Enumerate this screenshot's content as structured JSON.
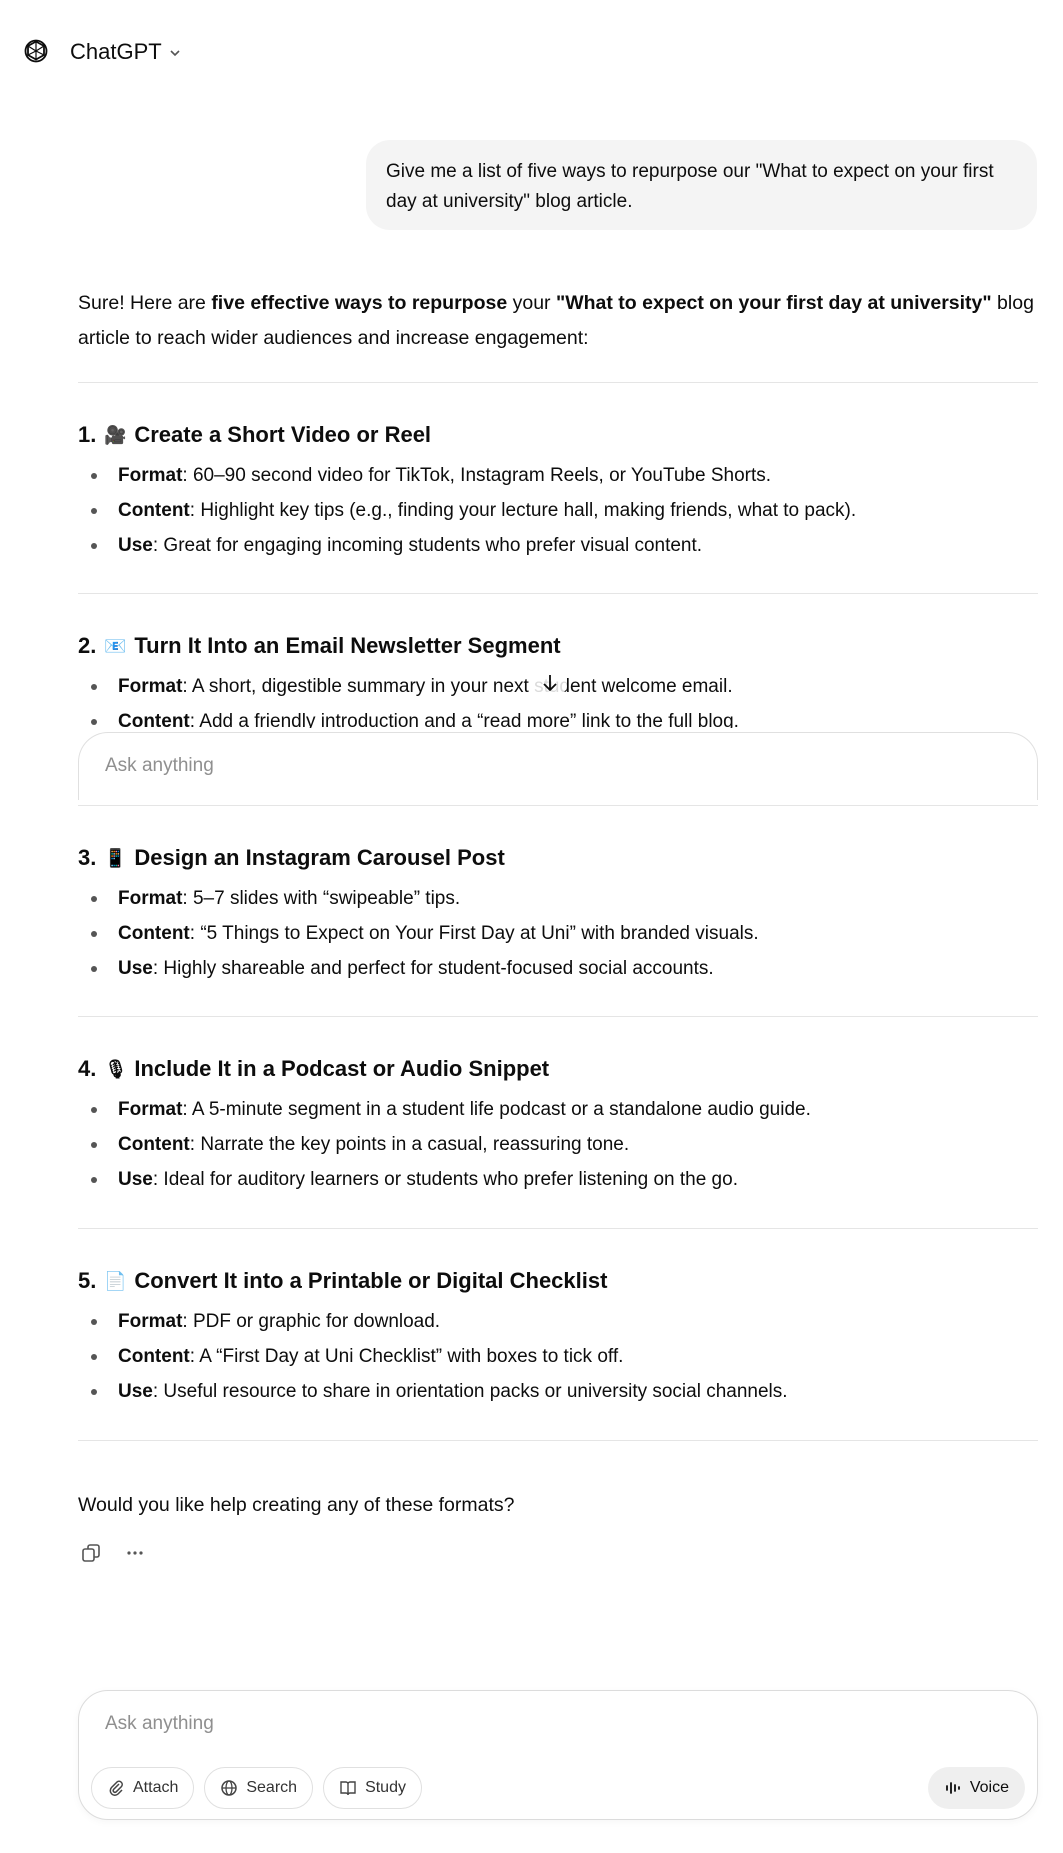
{
  "header": {
    "model_name": "ChatGPT"
  },
  "user_message": "Give me a list of five ways to repurpose our \"What to expect on your first day at university\" blog article.",
  "intro": {
    "p1": "Sure! Here are ",
    "b1": "five effective ways to repurpose",
    "p2": " your ",
    "b2": "\"What to expect on your first day at university\"",
    "p3": " blog article to reach wider audiences and increase engagement:"
  },
  "sections": [
    {
      "number": "1.",
      "emoji": "🎥",
      "title": "Create a Short Video or Reel",
      "items": [
        {
          "label": "Format",
          "text": ": 60–90 second video for TikTok, Instagram Reels, or YouTube Shorts."
        },
        {
          "label": "Content",
          "text": ": Highlight key tips (e.g., finding your lecture hall, making friends, what to pack)."
        },
        {
          "label": "Use",
          "text": ": Great for engaging incoming students who prefer visual content."
        }
      ]
    },
    {
      "number": "2.",
      "emoji": "📧",
      "title": "Turn It Into an Email Newsletter Segment",
      "items": [
        {
          "label": "Format",
          "text": ": A short, digestible summary in your next student welcome email."
        },
        {
          "label": "Content",
          "text": ": Add a friendly introduction and a “read more” link to the full blog."
        }
      ]
    },
    {
      "number": "3.",
      "emoji": "📱",
      "title": "Design an Instagram Carousel Post",
      "items": [
        {
          "label": "Format",
          "text": ": 5–7 slides with “swipeable” tips."
        },
        {
          "label": "Content",
          "text": ": “5 Things to Expect on Your First Day at Uni” with branded visuals."
        },
        {
          "label": "Use",
          "text": ": Highly shareable and perfect for student-focused social accounts."
        }
      ]
    },
    {
      "number": "4.",
      "emoji": "🎙",
      "title": "Include It in a Podcast or Audio Snippet",
      "items": [
        {
          "label": "Format",
          "text": ": A 5-minute segment in a student life podcast or a standalone audio guide."
        },
        {
          "label": "Content",
          "text": ": Narrate the key points in a casual, reassuring tone."
        },
        {
          "label": "Use",
          "text": ": Ideal for auditory learners or students who prefer listening on the go."
        }
      ]
    },
    {
      "number": "5.",
      "emoji": "📄",
      "title": "Convert It into a Printable or Digital Checklist",
      "items": [
        {
          "label": "Format",
          "text": ": PDF or graphic for download."
        },
        {
          "label": "Content",
          "text": ": A “First Day at Uni Checklist” with boxes to tick off."
        },
        {
          "label": "Use",
          "text": ": Useful resource to share in orientation packs or university social channels."
        }
      ]
    }
  ],
  "closing": "Would you like help creating any of these formats?",
  "composer": {
    "placeholder": "Ask anything",
    "attach": "Attach",
    "search": "Search",
    "study": "Study",
    "voice": "Voice"
  }
}
